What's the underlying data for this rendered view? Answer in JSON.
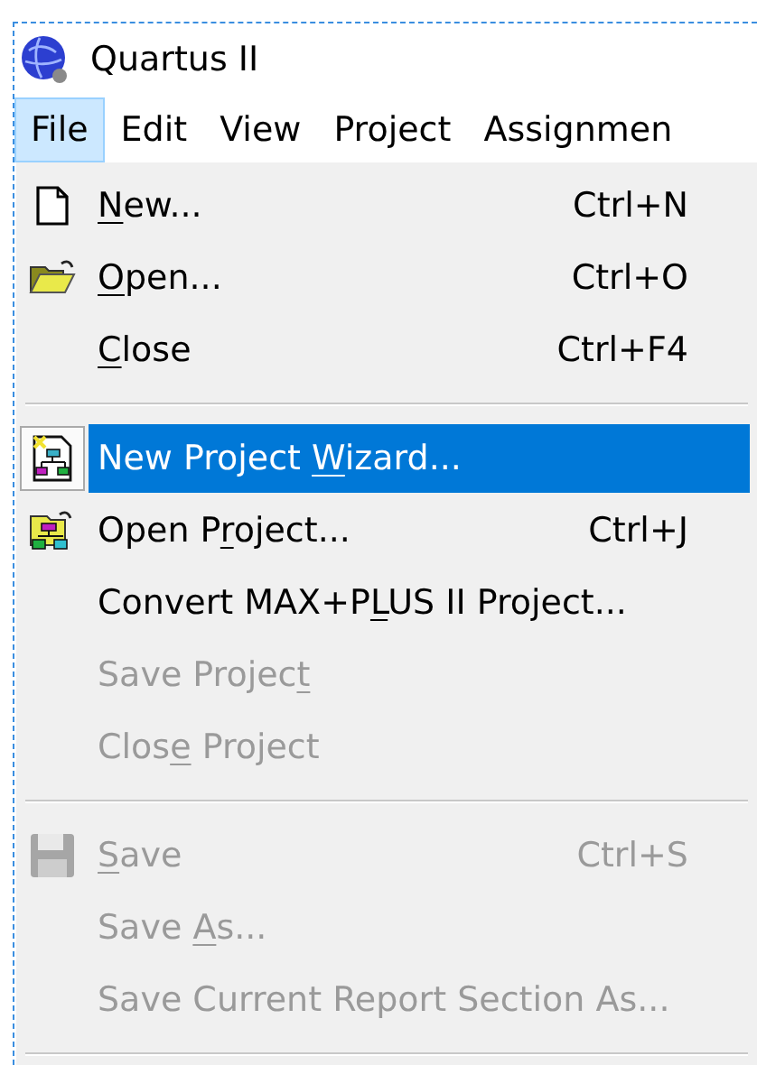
{
  "window": {
    "title": "Quartus II"
  },
  "menu_bar": [
    {
      "label": "File",
      "selected": true
    },
    {
      "label": "Edit",
      "selected": false
    },
    {
      "label": "View",
      "selected": false
    },
    {
      "label": "Project",
      "selected": false
    },
    {
      "label": "Assignmen",
      "selected": false
    }
  ],
  "file_menu": [
    {
      "kind": "item",
      "label": {
        "key": "N",
        "post": "ew..."
      },
      "shortcut": "Ctrl+N",
      "disabled": false,
      "selected": false
    },
    {
      "kind": "item",
      "label": {
        "key": "O",
        "post": "pen..."
      },
      "shortcut": "Ctrl+O",
      "disabled": false,
      "selected": false
    },
    {
      "kind": "item",
      "label": {
        "key": "C",
        "post": "lose"
      },
      "shortcut": "Ctrl+F4",
      "disabled": false,
      "selected": false
    },
    {
      "kind": "separator"
    },
    {
      "kind": "item",
      "label": {
        "pre": "New Project ",
        "key": "W",
        "post": "izard..."
      },
      "disabled": false,
      "selected": true
    },
    {
      "kind": "item",
      "label": {
        "pre": "Open P",
        "key": "r",
        "post": "oject..."
      },
      "shortcut": "Ctrl+J",
      "disabled": false,
      "selected": false
    },
    {
      "kind": "item",
      "label": {
        "pre": "Convert MAX+P",
        "key": "L",
        "post": "US II Project..."
      },
      "disabled": false,
      "selected": false
    },
    {
      "kind": "item",
      "label": {
        "pre": "Save Projec",
        "key": "t"
      },
      "disabled": true,
      "selected": false
    },
    {
      "kind": "item",
      "label": {
        "pre": "Clos",
        "key": "e",
        "post": " Project"
      },
      "disabled": true,
      "selected": false
    },
    {
      "kind": "separator"
    },
    {
      "kind": "item",
      "label": {
        "key": "S",
        "post": "ave"
      },
      "shortcut": "Ctrl+S",
      "disabled": true,
      "selected": false
    },
    {
      "kind": "item",
      "label": {
        "pre": "Save ",
        "key": "A",
        "post": "s..."
      },
      "disabled": true,
      "selected": false
    },
    {
      "kind": "item",
      "label": {
        "pre": "Save Current Report Section As..."
      },
      "disabled": true,
      "selected": false
    },
    {
      "kind": "separator"
    }
  ]
}
